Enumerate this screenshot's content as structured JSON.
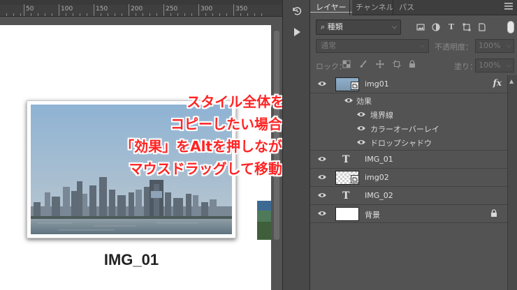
{
  "ruler": {
    "numbers": [
      "50",
      "100",
      "150",
      "200",
      "250",
      "300",
      "350"
    ]
  },
  "canvas": {
    "caption": "IMG_01"
  },
  "annotation": {
    "lines": [
      "スタイル全体を→",
      "コピーしたい場合は",
      "「効果」をAltを押しながら",
      "マウスドラッグして移動！"
    ],
    "color": "#ff2424"
  },
  "tools": {
    "icons": [
      "history-icon",
      "play-icon"
    ]
  },
  "panel": {
    "tabs": [
      "レイヤー",
      "チャンネル",
      "パス"
    ],
    "active_tab": "レイヤー",
    "filter": {
      "kind_label": "種類"
    },
    "blend_mode": "通常",
    "opacity_label": "不透明度：",
    "opacity_value": "100%",
    "lock_label": "ロック：",
    "fill_label": "塗り：",
    "fill_value": "100%"
  },
  "layers": [
    {
      "name": "img01",
      "type": "smart",
      "has_fx": true,
      "fx_label": "fx"
    },
    {
      "name": "効果",
      "type": "effects-header"
    },
    {
      "name": "境界線",
      "type": "effect"
    },
    {
      "name": "カラーオーバーレイ",
      "type": "effect"
    },
    {
      "name": "ドロップシャドウ",
      "type": "effect"
    },
    {
      "name": "IMG_01",
      "type": "text"
    },
    {
      "name": "img02",
      "type": "smart"
    },
    {
      "name": "IMG_02",
      "type": "text"
    },
    {
      "name": "背景",
      "type": "background",
      "locked": true
    }
  ]
}
